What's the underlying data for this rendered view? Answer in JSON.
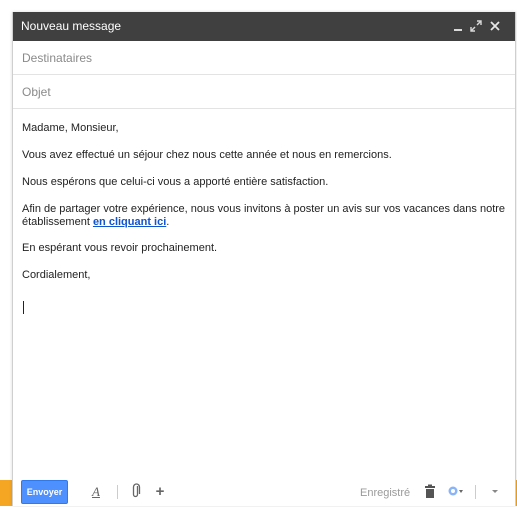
{
  "window": {
    "title": "Nouveau message",
    "minimize_icon": "minimize-icon",
    "expand_icon": "expand-icon",
    "close_icon": "close-icon"
  },
  "fields": {
    "to_placeholder": "Destinataires",
    "to_value": "",
    "subject_placeholder": "Objet",
    "subject_value": ""
  },
  "body": {
    "greeting": "Madame, Monsieur,",
    "line1": "Vous avez effectué un séjour chez nous cette année et nous en remercions.",
    "line2": "Nous espérons que celui-ci vous a apporté entière satisfaction.",
    "line3_before": "Afin de partager votre expérience, nous vous invitons à poster un avis sur vos vacances dans notre établissement ",
    "line3_link": "en cliquant ici",
    "line3_after": ".",
    "line4": "En espérant vous revoir prochainement.",
    "closing": "Cordialement,"
  },
  "toolbar": {
    "send_label": "Envoyer",
    "saved_status": "Enregistré",
    "icons": {
      "format": "text-format-icon",
      "attach": "paperclip-icon",
      "more_options": "plus-icon",
      "delete": "trash-icon",
      "labels": "label-icon",
      "more": "chevron-down-icon"
    }
  },
  "colors": {
    "titlebar": "#404040",
    "send_button": "#4d90fe",
    "link": "#1155cc",
    "accent": "#f5a623"
  }
}
